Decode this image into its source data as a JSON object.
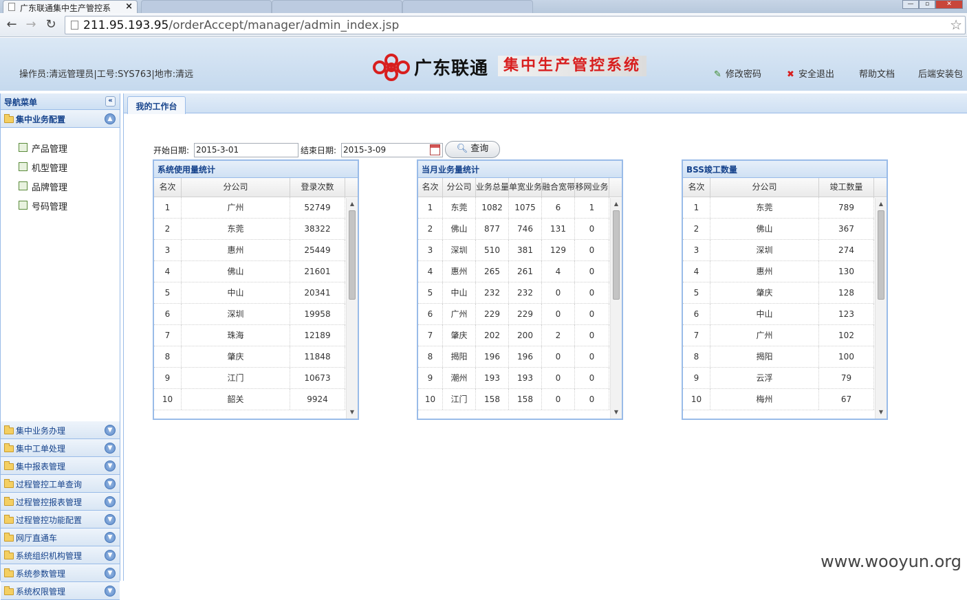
{
  "browser": {
    "tab_title": "广东联通集中生产管控系",
    "url_host": "211.95.193.95",
    "url_path": "/orderAccept/manager/admin_index.jsp"
  },
  "header": {
    "operator_info": "操作员:清远管理员|工号:SYS763|地市:清远",
    "brand": "广东联通",
    "system_name": "集中生产管控系统",
    "links": {
      "change_password": "修改密码",
      "logout": "安全退出",
      "help": "帮助文档",
      "client_install": "后端安装包"
    }
  },
  "nav": {
    "title": "导航菜单",
    "open_group": "集中业务配置",
    "sub_items": [
      "产品管理",
      "机型管理",
      "品牌管理",
      "号码管理"
    ],
    "groups": [
      "集中业务办理",
      "集中工单处理",
      "集中报表管理",
      "过程管控工单查询",
      "过程管控报表管理",
      "过程管控功能配置",
      "网厅直通车",
      "系统组织机构管理",
      "系统参数管理",
      "系统权限管理"
    ]
  },
  "workspace": {
    "tab": "我的工作台",
    "start_label": "开始日期:",
    "start_value": "2015-3-01",
    "end_label": "结束日期:",
    "end_value": "2015-3-09",
    "query_label": "查询"
  },
  "grids": {
    "usage": {
      "title": "系统使用量统计",
      "columns": [
        "名次",
        "分公司",
        "登录次数"
      ],
      "rows": [
        [
          "1",
          "广州",
          "52749"
        ],
        [
          "2",
          "东莞",
          "38322"
        ],
        [
          "3",
          "惠州",
          "25449"
        ],
        [
          "4",
          "佛山",
          "21601"
        ],
        [
          "5",
          "中山",
          "20341"
        ],
        [
          "6",
          "深圳",
          "19958"
        ],
        [
          "7",
          "珠海",
          "12189"
        ],
        [
          "8",
          "肇庆",
          "11848"
        ],
        [
          "9",
          "江门",
          "10673"
        ],
        [
          "10",
          "韶关",
          "9924"
        ]
      ]
    },
    "business": {
      "title": "当月业务量统计",
      "columns": [
        "名次",
        "分公司",
        "业务总量",
        "单宽业务",
        "融合宽带",
        "移网业务"
      ],
      "rows": [
        [
          "1",
          "东莞",
          "1082",
          "1075",
          "6",
          "1"
        ],
        [
          "2",
          "佛山",
          "877",
          "746",
          "131",
          "0"
        ],
        [
          "3",
          "深圳",
          "510",
          "381",
          "129",
          "0"
        ],
        [
          "4",
          "惠州",
          "265",
          "261",
          "4",
          "0"
        ],
        [
          "5",
          "中山",
          "232",
          "232",
          "0",
          "0"
        ],
        [
          "6",
          "广州",
          "229",
          "229",
          "0",
          "0"
        ],
        [
          "7",
          "肇庆",
          "202",
          "200",
          "2",
          "0"
        ],
        [
          "8",
          "揭阳",
          "196",
          "196",
          "0",
          "0"
        ],
        [
          "9",
          "潮州",
          "193",
          "193",
          "0",
          "0"
        ],
        [
          "10",
          "江门",
          "158",
          "158",
          "0",
          "0"
        ]
      ]
    },
    "bss": {
      "title": "BSS竣工数量",
      "columns": [
        "名次",
        "分公司",
        "竣工数量"
      ],
      "rows": [
        [
          "1",
          "东莞",
          "789"
        ],
        [
          "2",
          "佛山",
          "367"
        ],
        [
          "3",
          "深圳",
          "274"
        ],
        [
          "4",
          "惠州",
          "130"
        ],
        [
          "5",
          "肇庆",
          "128"
        ],
        [
          "6",
          "中山",
          "123"
        ],
        [
          "7",
          "广州",
          "102"
        ],
        [
          "8",
          "揭阳",
          "100"
        ],
        [
          "9",
          "云浮",
          "79"
        ],
        [
          "10",
          "梅州",
          "67"
        ]
      ]
    }
  },
  "watermark": "www.wooyun.org",
  "colors": {
    "accent": "#15428b",
    "border": "#99bbe8",
    "brand_red": "#d81e1e"
  }
}
